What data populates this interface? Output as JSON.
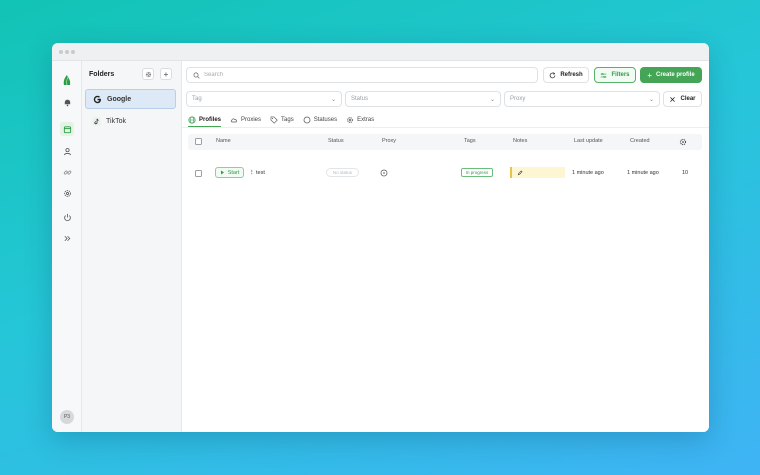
{
  "sidebar_folders": {
    "title": "Folders",
    "items": [
      {
        "label": "Google",
        "icon": "google-icon",
        "selected": true
      },
      {
        "label": "TikTok",
        "icon": "tiktok-icon",
        "selected": false
      }
    ]
  },
  "user": {
    "initials": "P3"
  },
  "toolbar": {
    "search_placeholder": "Search",
    "refresh_label": "Refresh",
    "filters_label": "Filters",
    "create_label": "Create profile",
    "clear_label": "Clear"
  },
  "filters": {
    "tag_placeholder": "Tag",
    "status_placeholder": "Status",
    "proxy_placeholder": "Proxy"
  },
  "tabs": [
    {
      "label": "Profiles",
      "icon": "globe-icon",
      "active": true
    },
    {
      "label": "Proxies",
      "icon": "cloud-icon",
      "active": false
    },
    {
      "label": "Tags",
      "icon": "tag-icon",
      "active": false
    },
    {
      "label": "Statuses",
      "icon": "status-circle-icon",
      "active": false
    },
    {
      "label": "Extras",
      "icon": "gear-icon",
      "active": false
    }
  ],
  "table": {
    "columns": {
      "name": "Name",
      "status": "Status",
      "proxy": "Proxy",
      "tags": "Tags",
      "notes": "Notes",
      "last_update": "Last update",
      "created": "Created"
    },
    "rows": [
      {
        "start_label": "Start",
        "name": "test",
        "status": "No status",
        "tag": "In progress",
        "last_update": "1 minute ago",
        "created": "1 minute ago",
        "extra": "10"
      }
    ]
  },
  "colors": {
    "accent": "#44a556",
    "selected_folder_bg": "#dde9f7",
    "note_bg": "#fdf6d3"
  }
}
